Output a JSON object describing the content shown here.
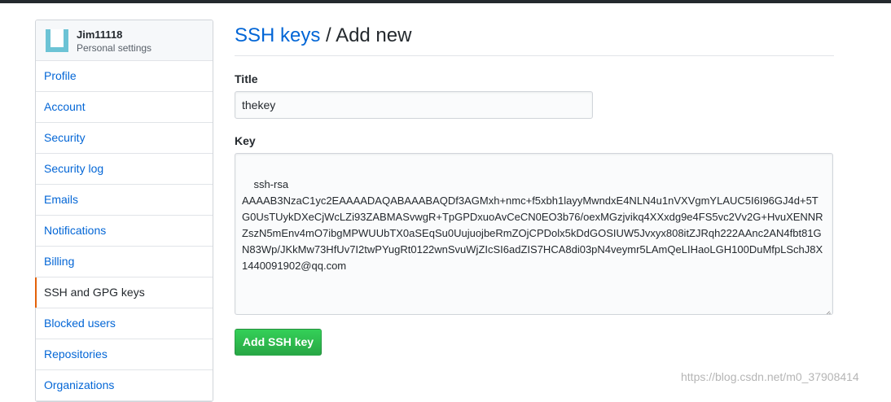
{
  "user": {
    "name": "Jim11118",
    "subtitle": "Personal settings"
  },
  "sidebar": {
    "items": [
      {
        "label": "Profile"
      },
      {
        "label": "Account"
      },
      {
        "label": "Security"
      },
      {
        "label": "Security log"
      },
      {
        "label": "Emails"
      },
      {
        "label": "Notifications"
      },
      {
        "label": "Billing"
      },
      {
        "label": "SSH and GPG keys",
        "selected": true
      },
      {
        "label": "Blocked users"
      },
      {
        "label": "Repositories"
      },
      {
        "label": "Organizations"
      }
    ]
  },
  "main": {
    "breadcrumb_link": "SSH keys",
    "breadcrumb_sep": "/",
    "breadcrumb_current": "Add new",
    "title_label": "Title",
    "title_value": "thekey",
    "key_label": "Key",
    "key_value": "ssh-rsa\nAAAAB3NzaC1yc2EAAAADAQABAAABAQDf3AGMxh+nmc+f5xbh1layyMwndxE4NLN4u1nVXVgmYLAUC5I6I96GJ4d+5TG0UsTUykDXeCjWcLZi93ZABMASvwgR+TpGPDxuoAvCeCN0EO3b76/oexMGzjvikq4XXxdg9e4FS5vc2Vv2G+HvuXENNRZszN5mEnv4mO7ibgMPWUUbTX0aSEqSu0UujuojbeRmZOjCPDolx5kDdGOSIUW5Jvxyx808itZJRqh222AAnc2AN4fbt81GN83Wp/JKkMw73HfUv7I2twPYugRt0122wnSvuWjZIcSI6adZIS7HCA8di03pN4veymr5LAmQeLIHaoLGH100DuMfpLSchJ8X 1440091902@qq.com",
    "submit_label": "Add SSH key"
  },
  "watermark": "https://blog.csdn.net/m0_37908414",
  "colors": {
    "link": "#0366d6",
    "selected_marker": "#e36209",
    "button_green": "#28a745",
    "avatar": "#6cc3d5"
  }
}
